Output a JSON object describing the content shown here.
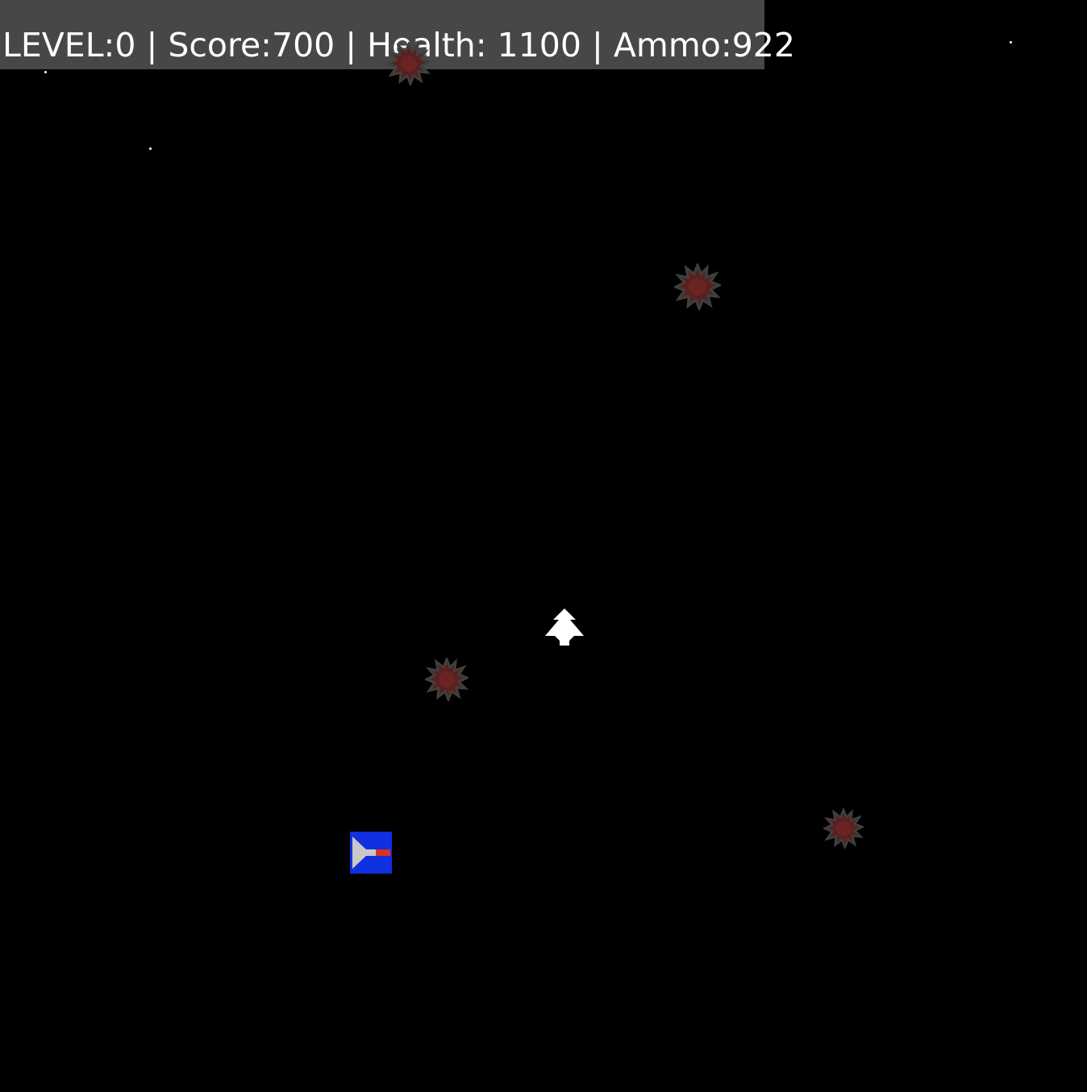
{
  "hud": {
    "level_label": "LEVEL:",
    "level_value": "0",
    "score_label": "Score:",
    "score_value": "700",
    "health_label": "Health: ",
    "health_value": "1100",
    "ammo_label": "Ammo:",
    "ammo_value": "922",
    "separator": " | "
  },
  "colors": {
    "background": "#000000",
    "hud_bar": "#474747",
    "hud_text": "#ffffff",
    "enemy": "#5a2020",
    "enemy_edge": "#3f3f3f",
    "player": "#ffffff",
    "pickup_body": "#1030e0",
    "pickup_arrow": "#c8c8c8",
    "pickup_accent": "#e03020"
  },
  "sprites": {
    "player": "player-ship-icon",
    "enemy": "spiked-mine-icon",
    "pickup": "ammo-crate-icon"
  }
}
